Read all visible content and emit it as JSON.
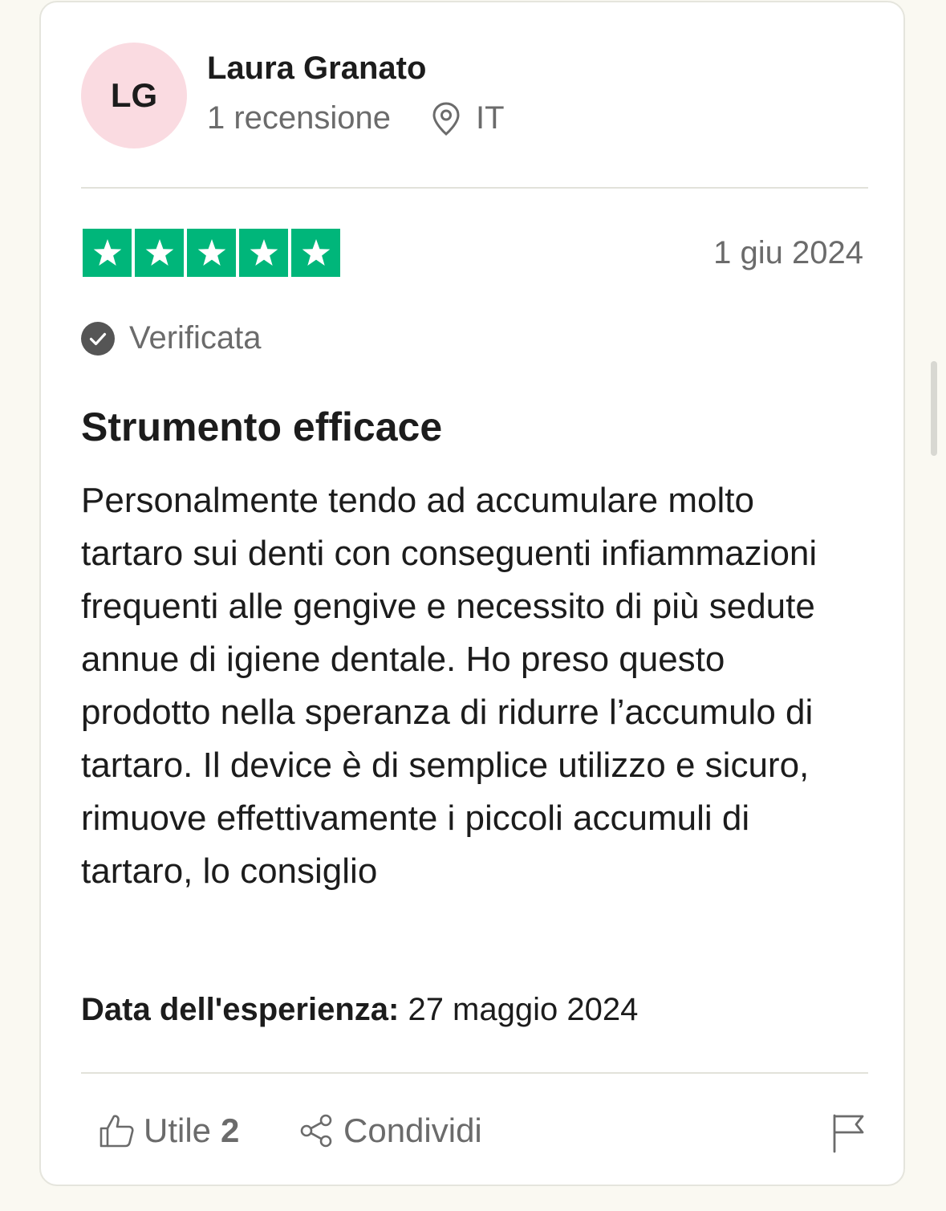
{
  "reviewer": {
    "initials": "LG",
    "name": "Laura Granato",
    "review_count": "1 recensione",
    "country": "IT",
    "avatar_color": "#fadbe1"
  },
  "review": {
    "rating": 5,
    "rating_max": 5,
    "star_color": "#00b67a",
    "date": "1 giu 2024",
    "verified_label": "Verificata",
    "title": "Strumento efficace",
    "body": "Personalmente tendo ad accumulare molto tartaro sui denti con conseguenti infiammazioni frequenti alle gengive e necessito di più sedute annue di igiene dentale. Ho preso questo prodotto nella speranza di ridurre l’accumulo di tartaro. Il device è di semplice utilizzo e sicuro, rimuove effettivamente i piccoli accumuli di tartaro, lo consiglio",
    "experience_label": "Data dell'esperienza:",
    "experience_date": "27 maggio 2024"
  },
  "actions": {
    "useful_label": "Utile",
    "useful_count": "2",
    "share_label": "Condividi"
  }
}
